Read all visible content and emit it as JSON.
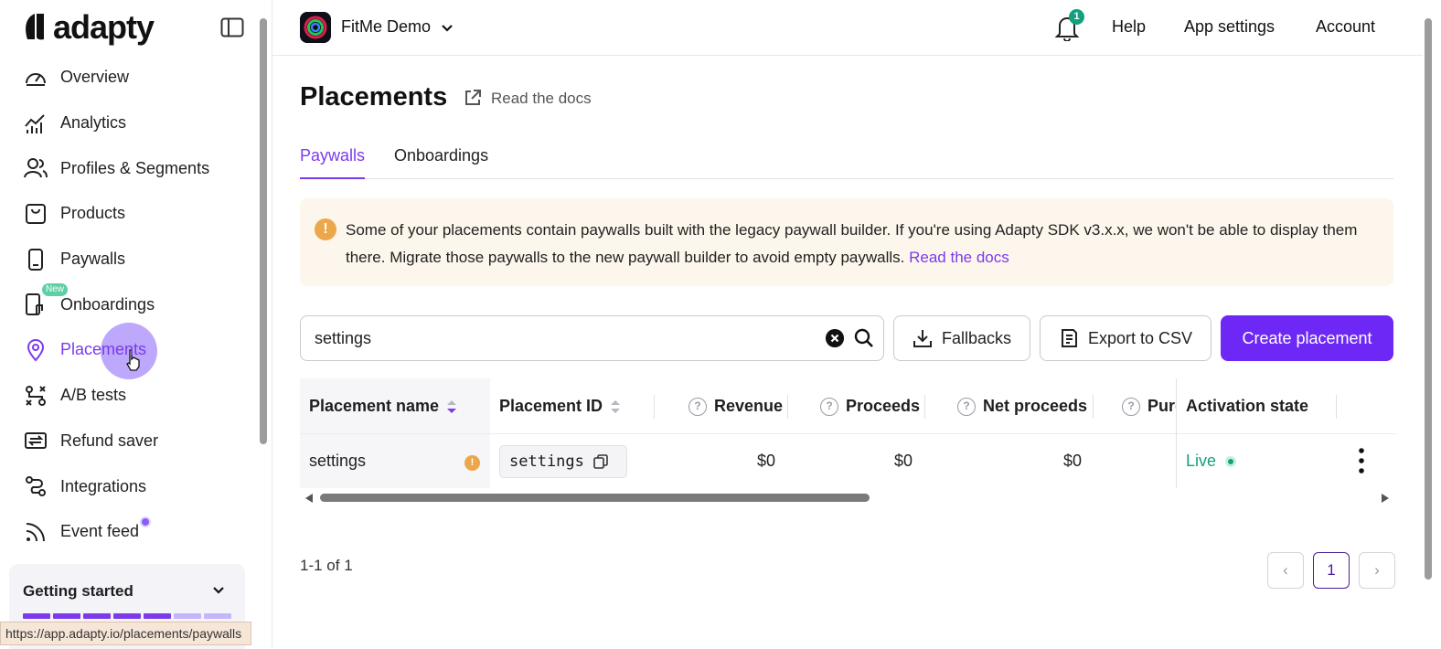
{
  "sidebar": {
    "logo_text": "adapty",
    "items": [
      {
        "label": "Overview",
        "icon": "gauge-icon"
      },
      {
        "label": "Analytics",
        "icon": "analytics-icon"
      },
      {
        "label": "Profiles & Segments",
        "icon": "users-icon"
      },
      {
        "label": "Products",
        "icon": "box-icon"
      },
      {
        "label": "Paywalls",
        "icon": "phone-icon"
      },
      {
        "label": "Onboardings",
        "icon": "onboarding-icon",
        "badge": "New"
      },
      {
        "label": "Placements",
        "icon": "location-pin-icon",
        "active": true
      },
      {
        "label": "A/B tests",
        "icon": "ab-test-icon"
      },
      {
        "label": "Refund saver",
        "icon": "refund-icon"
      },
      {
        "label": "Integrations",
        "icon": "integrations-icon"
      },
      {
        "label": "Event feed",
        "icon": "rss-icon",
        "dot": true
      }
    ],
    "getting_started": {
      "title": "Getting started",
      "steps_done": 5,
      "steps_total": 7
    },
    "status_url": "https://app.adapty.io/placements/paywalls"
  },
  "topbar": {
    "app_name": "FitMe Demo",
    "notifications": "1",
    "links": [
      "Help",
      "App settings",
      "Account"
    ]
  },
  "main": {
    "title": "Placements",
    "docs_link": "Read the docs",
    "tabs": [
      {
        "label": "Paywalls",
        "active": true
      },
      {
        "label": "Onboardings"
      }
    ],
    "alert": {
      "text": "Some of your placements contain paywalls built with the legacy paywall builder. If you're using Adapty SDK v3.x.x, we won't be able to display them there. Migrate those paywalls to the new paywall builder to avoid empty paywalls.",
      "link": "Read the docs"
    },
    "search": {
      "value": "settings"
    },
    "buttons": {
      "fallbacks": "Fallbacks",
      "export": "Export to CSV",
      "create": "Create placement"
    },
    "table": {
      "columns": [
        "Placement name",
        "Placement ID",
        "Revenue",
        "Proceeds",
        "Net proceeds",
        "Purc",
        "Activation state"
      ],
      "rows": [
        {
          "name": "settings",
          "id": "settings",
          "revenue": "$0",
          "proceeds": "$0",
          "net_proceeds": "$0",
          "state": "Live"
        }
      ]
    },
    "pagination": {
      "info": "1-1 of 1",
      "current": "1",
      "prev": "‹",
      "next": "›"
    }
  },
  "colors": {
    "accent": "#7c3aed",
    "primary_button": "#6d28f5",
    "live": "#13a07e",
    "warning": "#eda74b"
  }
}
